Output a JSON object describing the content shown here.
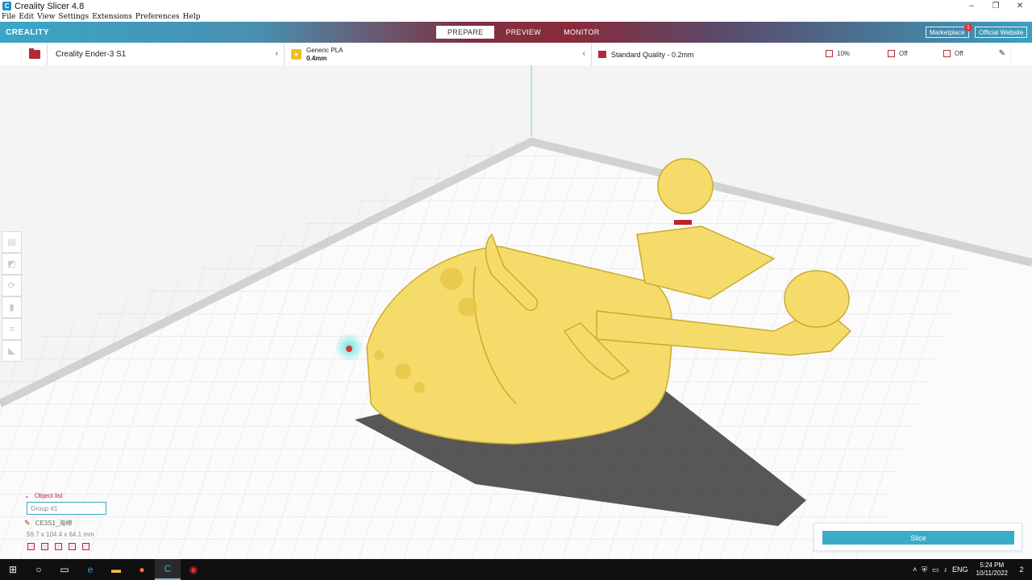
{
  "window": {
    "title": "Creality Slicer 4.8",
    "app_icon": "C",
    "minimize": "–",
    "maximize": "❐",
    "close": "✕"
  },
  "menu": [
    "File",
    "Edit",
    "View",
    "Settings",
    "Extensions",
    "Preferences",
    "Help"
  ],
  "header": {
    "brand": "CREALITY",
    "tabs": [
      {
        "label": "PREPARE",
        "active": true
      },
      {
        "label": "PREVIEW"
      },
      {
        "label": "MONITOR"
      }
    ],
    "marketplace": "Marketplace",
    "marketplace_badge": "1",
    "official_website": "Official Website"
  },
  "toolbar": {
    "printer": "Creality Ender-3 S1",
    "material_name": "Generic PLA",
    "nozzle": "0.4mm",
    "quality": "Standard Quality - 0.2mm",
    "infill": "10%",
    "support": "Off",
    "adhesion": "Off"
  },
  "object_list": {
    "title": "Object list",
    "group_name": "Group #1",
    "file": "CE3S1_海绵",
    "dims": "59.7 x 104.4 x 64.1 mm"
  },
  "slice": {
    "label": "Slice"
  },
  "taskbar": {
    "time": "5:24 PM",
    "date": "10/11/2022",
    "language": "ENG",
    "notifications": "2"
  },
  "colors": {
    "accent": "#3aacc8",
    "brand_red": "#b02a3a",
    "model": "#f5dc6a"
  }
}
